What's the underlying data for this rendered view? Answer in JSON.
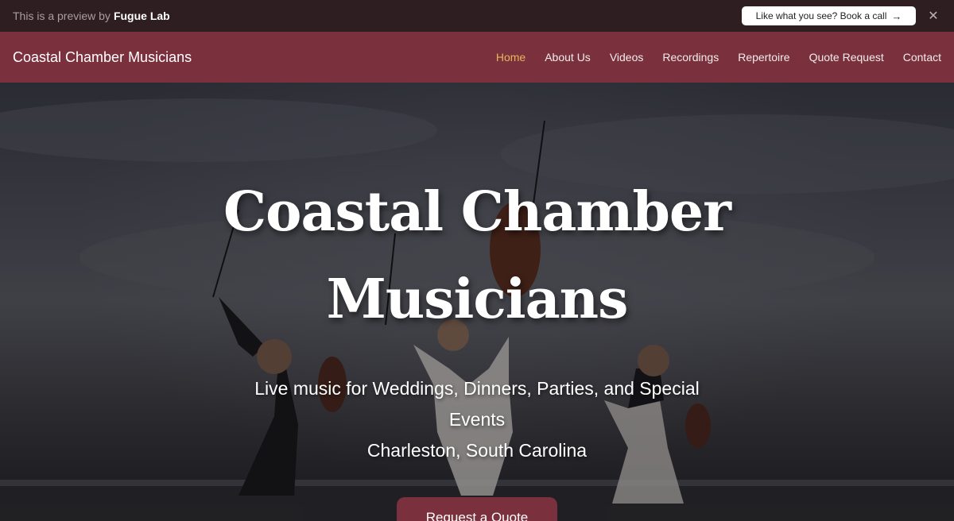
{
  "preview_bar": {
    "text": "This is a preview by",
    "brand": "Fugue Lab",
    "cta_label": "Like what you see? Book a call",
    "cta_icon": "arrow-right-icon",
    "close_icon": "close-icon"
  },
  "nav": {
    "site_title": "Coastal Chamber Musicians",
    "links": [
      "Home",
      "About Us",
      "Videos",
      "Recordings",
      "Repertoire",
      "Quote Request",
      "Contact"
    ],
    "active": "Home",
    "active_color": "#e8b45a",
    "bar_color": "#7b313d"
  },
  "hero": {
    "title": "Coastal Chamber Musicians",
    "subtitle_line1": "Live music for Weddings, Dinners, Parties, and Special Events",
    "subtitle_line2": "Charleston, South Carolina",
    "cta_label": "Request a Quote"
  }
}
